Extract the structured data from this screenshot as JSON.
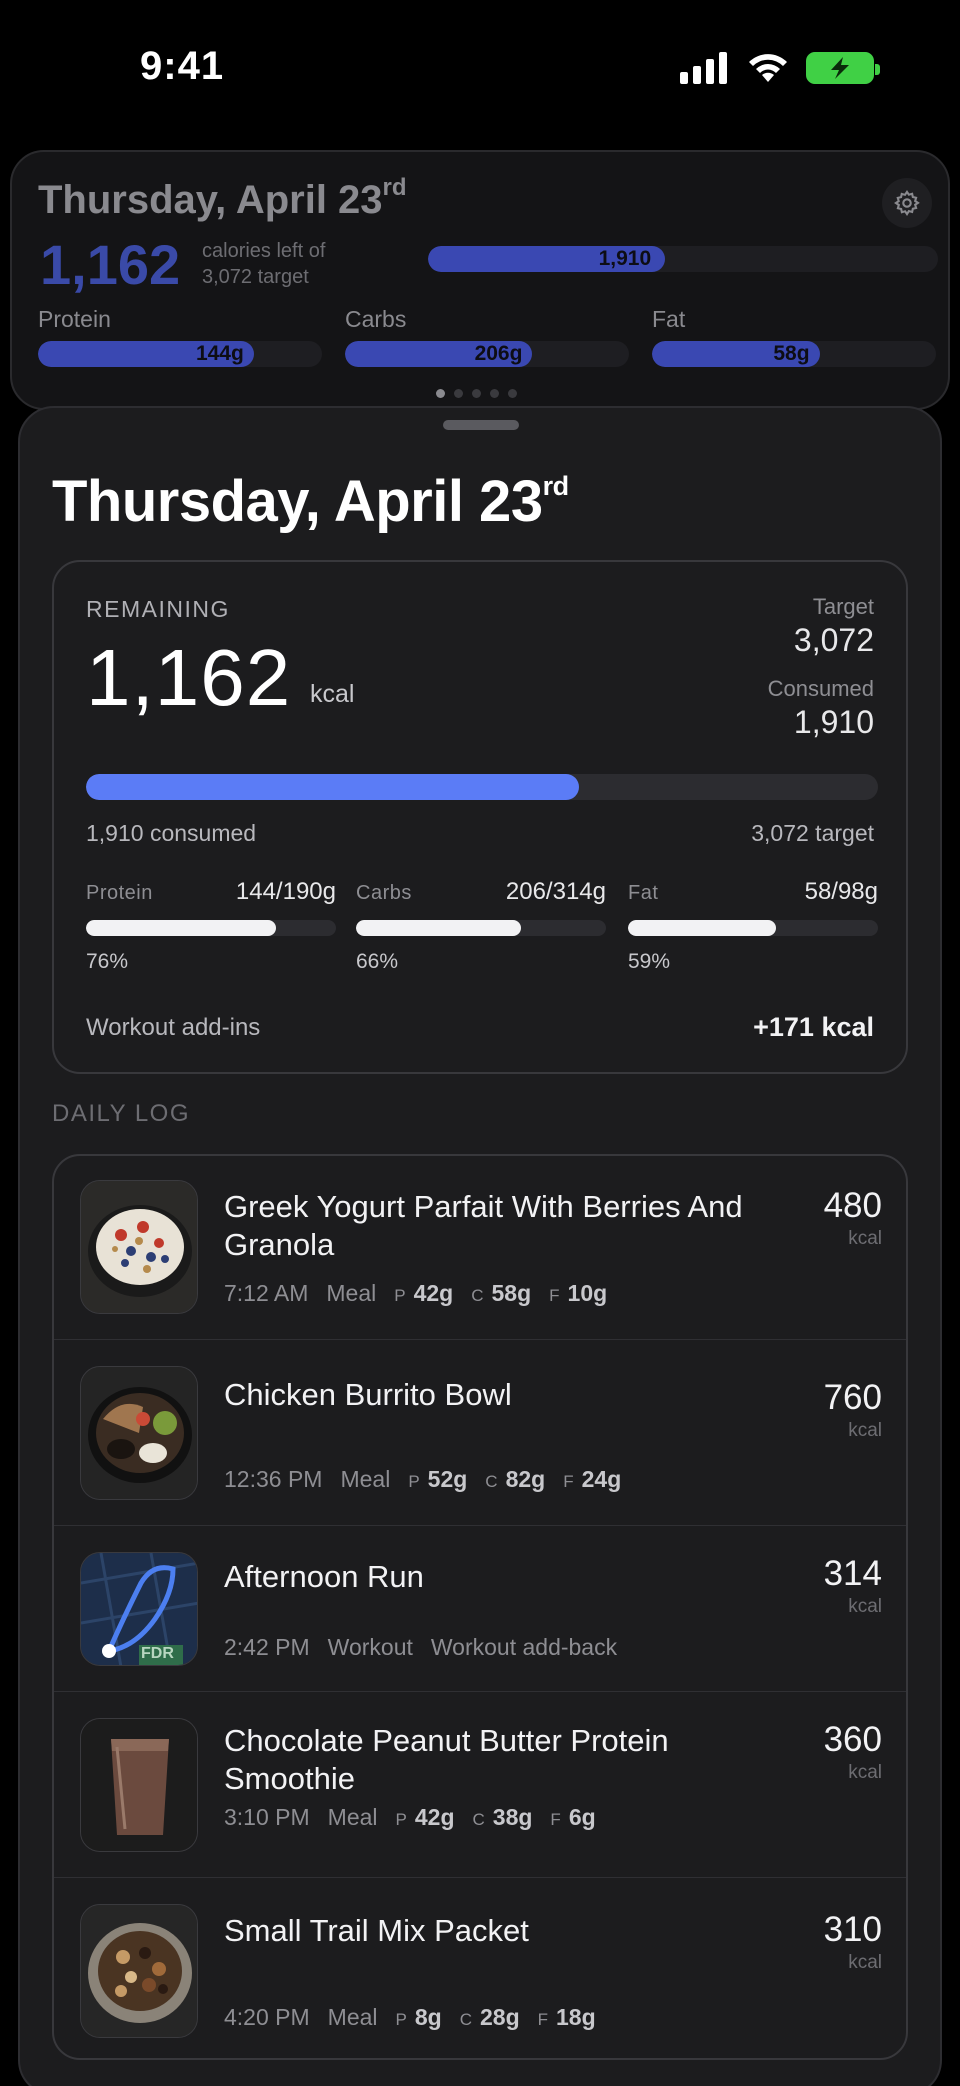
{
  "status_bar": {
    "time": "9:41"
  },
  "widget": {
    "title_main": "Thursday, April 23",
    "title_suffix": "rd",
    "remaining": "1,162",
    "caption_line1": "calories left of",
    "caption_line2": "3,072 target",
    "consumed_label": "1,910",
    "consumed_fraction": 0.465,
    "macros": [
      {
        "name": "Protein",
        "value": "144g",
        "fraction": 0.76
      },
      {
        "name": "Carbs",
        "value": "206g",
        "fraction": 0.66
      },
      {
        "name": "Fat",
        "value": "58g",
        "fraction": 0.59
      }
    ],
    "page_count": 5,
    "active_page": 0
  },
  "sheet": {
    "title_main": "Thursday, April 23",
    "title_suffix": "rd",
    "summary": {
      "remaining_label": "REMAINING",
      "remaining_value": "1,162",
      "remaining_unit": "kcal",
      "target_label": "Target",
      "target_value": "3,072",
      "consumed_label": "Consumed",
      "consumed_value": "1,910",
      "progress_fraction": 0.622,
      "consumed_caption": "1,910 consumed",
      "target_caption": "3,072 target",
      "macros": [
        {
          "name": "Protein",
          "amount": "144/190g",
          "percent": "76%",
          "fraction": 0.76
        },
        {
          "name": "Carbs",
          "amount": "206/314g",
          "percent": "66%",
          "fraction": 0.66
        },
        {
          "name": "Fat",
          "amount": "58/98g",
          "percent": "59%",
          "fraction": 0.59
        }
      ],
      "workout_label": "Workout add-ins",
      "workout_value": "+171 kcal"
    },
    "daily_log_label": "DAILY LOG",
    "log": [
      {
        "title": "Greek Yogurt Parfait With Berries And Granola",
        "time": "7:12 AM",
        "kind": "Meal",
        "p": "42g",
        "c": "58g",
        "f": "10g",
        "kcal": "480",
        "unit": "kcal",
        "icon": "yogurt-parfait-photo"
      },
      {
        "title": "Chicken Burrito Bowl",
        "time": "12:36 PM",
        "kind": "Meal",
        "p": "52g",
        "c": "82g",
        "f": "24g",
        "kcal": "760",
        "unit": "kcal",
        "icon": "burrito-bowl-photo"
      },
      {
        "title": "Afternoon Run",
        "time": "2:42 PM",
        "kind": "Workout",
        "note": "Workout add-back",
        "kcal": "314",
        "unit": "kcal",
        "icon": "run-route-map",
        "map_label": "FDR"
      },
      {
        "title": "Chocolate Peanut Butter Protein Smoothie",
        "time": "3:10 PM",
        "kind": "Meal",
        "p": "42g",
        "c": "38g",
        "f": "6g",
        "kcal": "360",
        "unit": "kcal",
        "icon": "smoothie-photo"
      },
      {
        "title": "Small Trail Mix Packet",
        "time": "4:20 PM",
        "kind": "Meal",
        "p": "8g",
        "c": "28g",
        "f": "18g",
        "kcal": "310",
        "unit": "kcal",
        "icon": "trail-mix-photo"
      }
    ],
    "macro_keys": {
      "p": "P",
      "c": "C",
      "f": "F"
    }
  },
  "colors": {
    "accent": "#5b7cf6",
    "widget_fill": "#3a48b2",
    "battery": "#40d045"
  }
}
